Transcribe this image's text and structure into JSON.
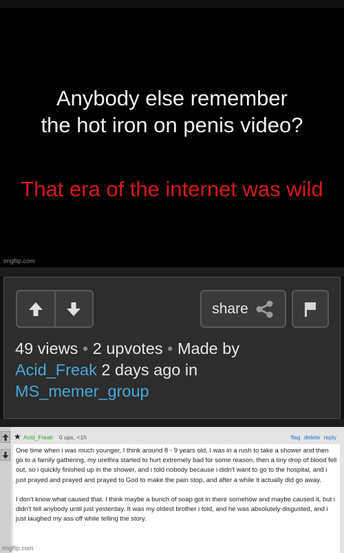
{
  "meme": {
    "line1": "Anybody else remember",
    "line2": "the hot iron on penis video?",
    "line3": "That era of the internet was wild",
    "watermark": "imgflip.com"
  },
  "panel": {
    "upvote_icon": "arrow-up-icon",
    "downvote_icon": "arrow-down-icon",
    "share_label": "share",
    "share_icon": "share-icon",
    "flag_icon": "flag-icon",
    "views": "49 views",
    "upvotes": "2 upvotes",
    "made_by": "Made by",
    "author": "Acid_Freak",
    "time_ago": "2 days ago in",
    "stream": "MS_memer_group",
    "separator": "•"
  },
  "comment": {
    "username": "Acid_Freak",
    "meta": "0 ups, <1h",
    "actions": [
      "flag",
      "delete",
      "reply"
    ],
    "paragraph1": "One time when i was much younger, I think around 8 - 9 years old, I was in a rush to take a shower and then go to a family gathering, my urethra started to hurt extremely bad for some reason, then a tiny drop of blood fell out, so i quickly finished up in the shower, and i told nobody because i didn't want to go to the hospital, and i just prayed and prayed and prayed to God to make the pain stop, and after a while it actually did go away.",
    "paragraph2": "I don't know what caused that. I think maybe a bunch of soap got in there somehow and maybe caused it, but i didn't tell anybody until just yesterday. It was my oldest brother i told, and he was absolutely disgusted, and i just laughed my ass off while telling the story."
  },
  "footer_watermark": "imgflip.com",
  "colors": {
    "accent_link": "#49a7d6",
    "meme_red": "#d3191e",
    "username_green": "#2ea52e",
    "action_blue": "#2a6fd0"
  }
}
